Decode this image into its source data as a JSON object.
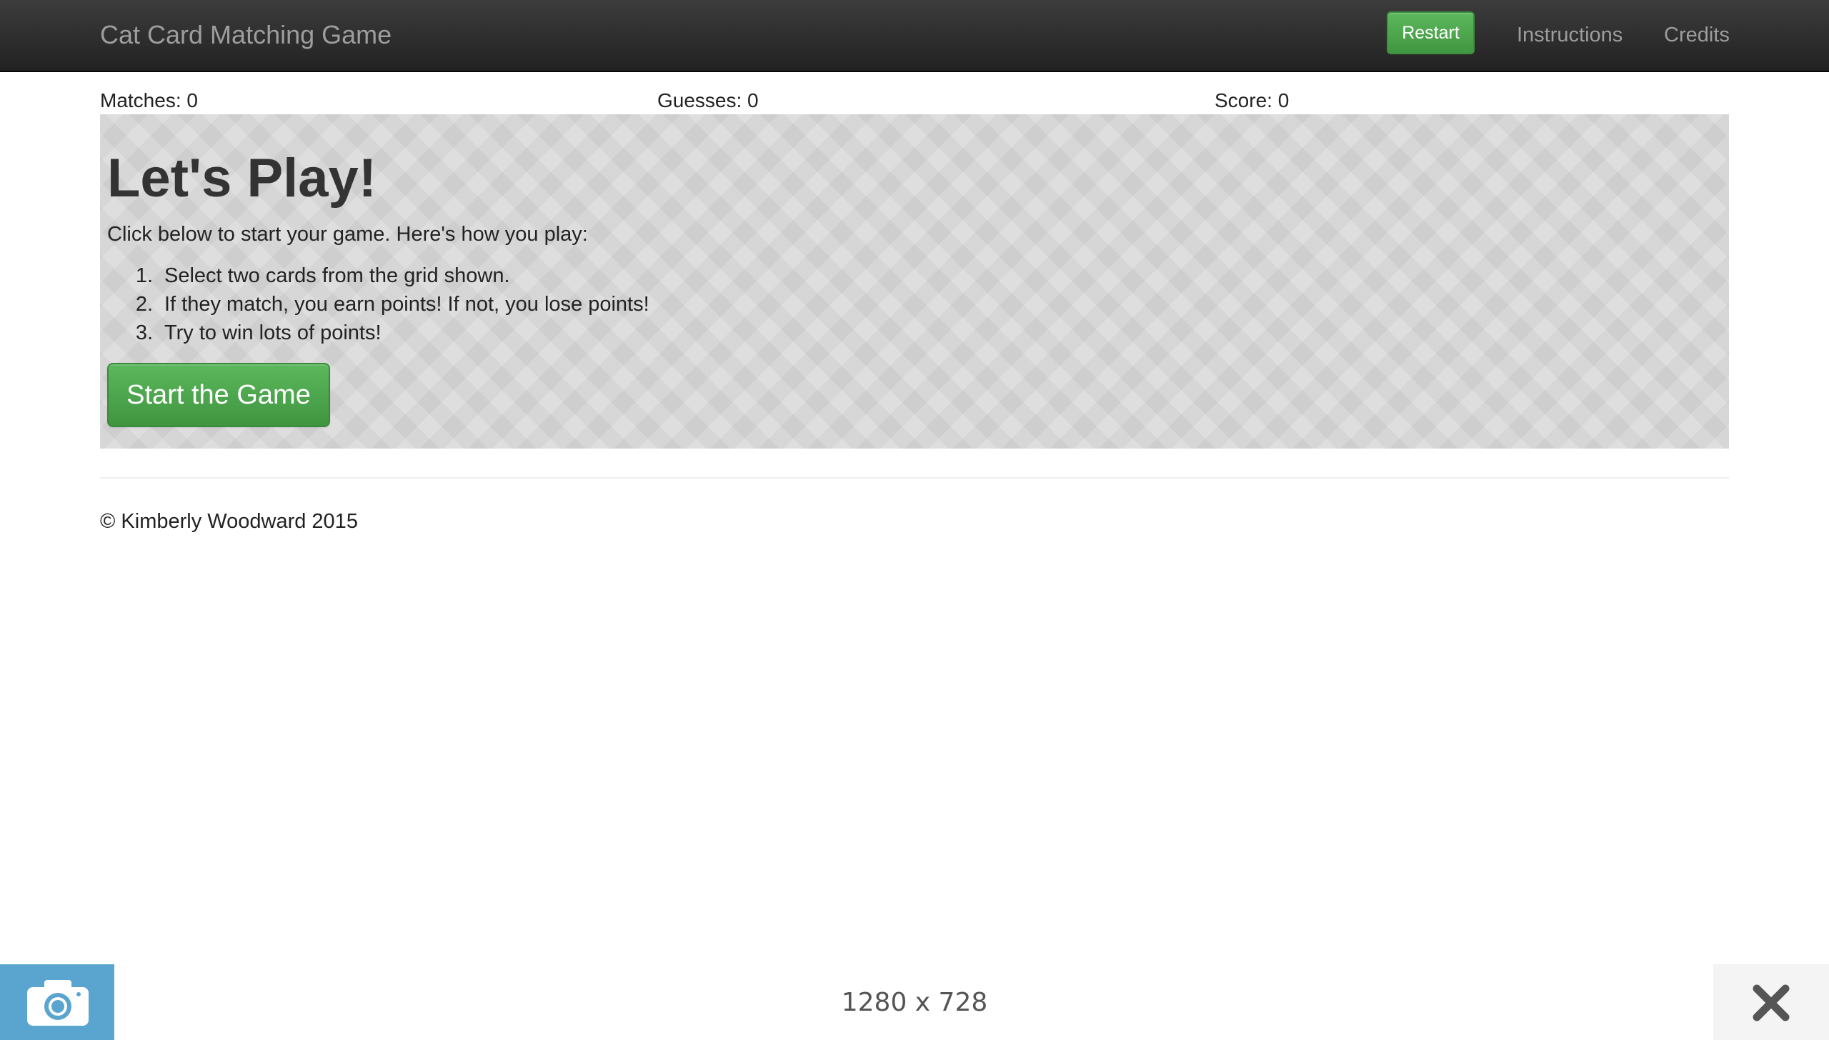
{
  "navbar": {
    "brand": "Cat Card Matching Game",
    "restart_label": "Restart",
    "links": [
      "Instructions",
      "Credits"
    ]
  },
  "stats": {
    "matches": "Matches: 0",
    "guesses": "Guesses: 0",
    "score": "Score: 0"
  },
  "intro": {
    "title": "Let's Play!",
    "description": "Click below to start your game. Here's how you play:",
    "rules": [
      {
        "num": "1.",
        "text": "Select two cards from the grid shown."
      },
      {
        "num": "2.",
        "text": "If they match, you earn points! If not, you lose points!"
      },
      {
        "num": "3.",
        "text": "Try to win lots of points!"
      }
    ],
    "start_label": "Start the Game"
  },
  "footer": {
    "copyright": "© Kimberly Woodward 2015"
  },
  "capture_bar": {
    "dimensions": "1280 x 728",
    "camera_icon": "camera-icon",
    "close_icon": "close-icon"
  },
  "colors": {
    "navbar": "#222222",
    "accent_green": "#5cb85c",
    "jumbotron": "#d6d6d6",
    "capture_blue": "#5aa5d0"
  }
}
